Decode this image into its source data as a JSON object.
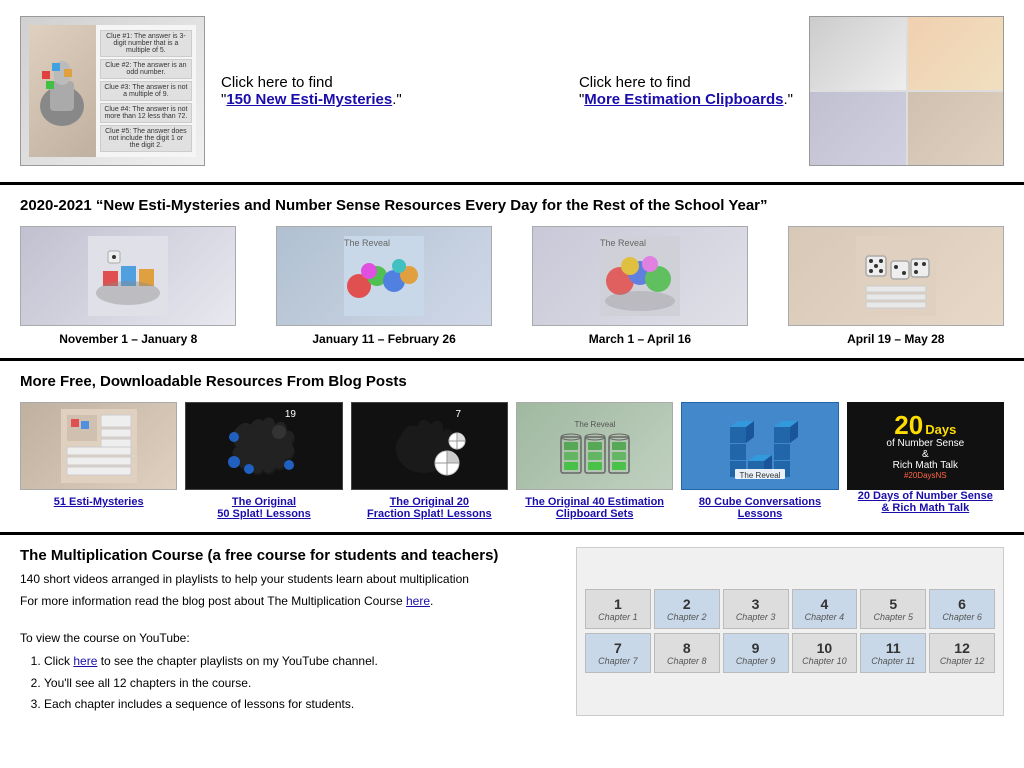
{
  "section_top": {
    "left_click_text": "Click here to find",
    "left_link_text": "150 New Esti-Mysteries",
    "left_suffix": ".",
    "right_click_text": "Click here to find",
    "right_link_text": "More Estimation Clipboards",
    "right_suffix": "."
  },
  "section_2021": {
    "heading": "2020-2021 “New Esti-Mysteries and Number Sense Resources Every Day for the Rest of the School Year”",
    "playlists": [
      {
        "label": "November  1 – January 8"
      },
      {
        "label": "January 11 – February 26"
      },
      {
        "label": "March 1 – April 16"
      },
      {
        "label": "April 19 – May 28"
      }
    ]
  },
  "section_resources": {
    "heading": "More Free, Downloadable Resources From Blog Posts",
    "items": [
      {
        "link": "51 Esti-Mysteries"
      },
      {
        "link": "The Original\n50 Splat! Lessons"
      },
      {
        "link": "The Original 20\nFraction Splat! Lessons"
      },
      {
        "link": "The Original 40 Estimation\nClipboard Sets"
      },
      {
        "link": "80 Cube Conversations\nLessons"
      },
      {
        "link": "20 Days of Number Sense\n& Rich Math Talk"
      }
    ]
  },
  "section_mult": {
    "heading": "The Multiplication Course (a free course for students and teachers)",
    "line1": "140 short videos arranged in playlists to help your students learn about multiplication",
    "line2": "For more information read the blog post about The Multiplication Course ",
    "link_here": "here",
    "line3": ".",
    "view_text": "To view the course on YouTube:",
    "steps": [
      {
        "text": "Click ",
        "link": "here",
        "suffix": " to see the chapter playlists on my YouTube channel."
      },
      {
        "text": "You'll see all 12 chapters in the course."
      },
      {
        "text": "Each chapter includes a sequence of lessons for students."
      }
    ],
    "thumb_labels": [
      "1",
      "2",
      "3",
      "4",
      "5",
      "6",
      "7",
      "8",
      "9",
      "10",
      "11",
      "12"
    ]
  },
  "colors": {
    "link": "#1a0dab",
    "border": "#000",
    "accent_yellow": "#ffdd00",
    "accent_red": "#ff6644",
    "dark_bg": "#111"
  }
}
